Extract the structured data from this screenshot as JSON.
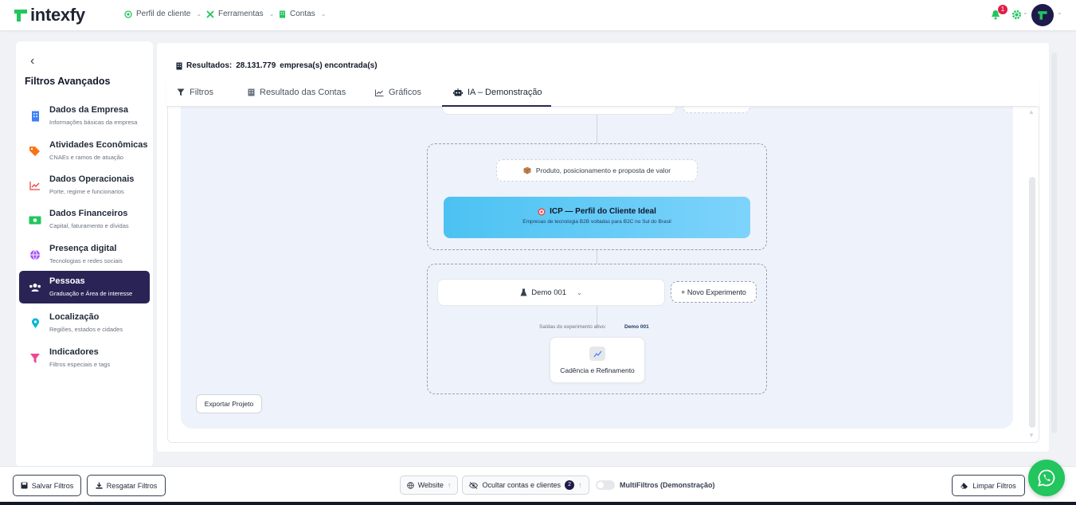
{
  "brand": {
    "name": "intexfy",
    "accent": "#22c55e",
    "primary": "#2a2456"
  },
  "topnav": [
    {
      "label": "Perfil de cliente",
      "icon": "target-icon"
    },
    {
      "label": "Ferramentas",
      "icon": "tools-icon"
    },
    {
      "label": "Contas",
      "icon": "building-icon"
    }
  ],
  "notifications": {
    "count": "1"
  },
  "sidebar": {
    "title": "Filtros Avançados",
    "items": [
      {
        "label": "Dados da Empresa",
        "sub": "Informações básicas da empresa",
        "icon": "building-icon",
        "color": "#3b82f6"
      },
      {
        "label": "Atividades Econômicas",
        "sub": "CNAEs e ramos de atuação",
        "icon": "tags-icon",
        "color": "#f97316"
      },
      {
        "label": "Dados Operacionais",
        "sub": "Porte, regime e funcionarios",
        "icon": "chart-line-icon",
        "color": "#ef4444"
      },
      {
        "label": "Dados Financeiros",
        "sub": "Capital, faturamento e dívidas",
        "icon": "money-icon",
        "color": "#22c55e"
      },
      {
        "label": "Presença digital",
        "sub": "Tecnologias e redes sociais",
        "icon": "globe-icon",
        "color": "#a855f7"
      },
      {
        "label": "Pessoas",
        "sub": "Graduação e Área de interesse",
        "icon": "users-icon",
        "color": "#ffffff"
      },
      {
        "label": "Localização",
        "sub": "Regiões, estados e cidades",
        "icon": "map-pin-icon",
        "color": "#06b6d4"
      },
      {
        "label": "Indicadores",
        "sub": "Filtros especiais e tags",
        "icon": "filter-icon",
        "color": "#ec4899"
      }
    ]
  },
  "results": {
    "label": "Resultados:",
    "count": "28.131.779",
    "suffix": "empresa(s) encontrada(s)"
  },
  "tabs": [
    {
      "label": "Filtros"
    },
    {
      "label": "Resultado das Contas"
    },
    {
      "label": "Gráficos"
    },
    {
      "label": "IA – Demonstração"
    }
  ],
  "flow": {
    "product_pill": "Produto, posicionamento e proposta de valor",
    "icp_title": "ICP — Perfil do Cliente Ideal",
    "icp_sub": "Empresas de tecnologia B2B voltadas para B2C no Sul do Brasil",
    "experiment_select": "Demo 001",
    "new_experiment": "+ Novo Experimento",
    "outputs_label": "Saídas do experimento ativo:",
    "outputs_value": "Demo 001",
    "output_card": "Cadência e Refinamento",
    "export_button": "Exportar Projeto"
  },
  "bottom": {
    "save": "Salvar Filtros",
    "load": "Resgatar Filtros",
    "website": "Website",
    "hide": "Ocultar contas e clientes",
    "hide_count": "2",
    "multifilter": "MultiFiltros (Demonstração)",
    "clear": "Limpar Filtros"
  }
}
